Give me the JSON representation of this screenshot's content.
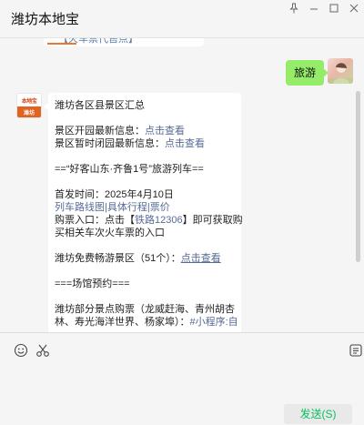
{
  "window": {
    "title": "潍坊本地宝"
  },
  "chat": {
    "previous_card_text": "【火车票代售点】",
    "my_message": "旅游",
    "bot_avatar": {
      "top_text": "本地宝",
      "bottom_text": "潍坊"
    },
    "bot_message": {
      "title": "潍坊各区县景区汇总",
      "open_prefix": "景区开园最新信息：",
      "open_link": "点击查看",
      "closed_prefix": "景区暂时闭园最新信息：",
      "closed_link": "点击查看",
      "train_heading": "==“好客山东·齐鲁1号”旅游列车==",
      "first_departure": "首发时间：2025年4月10日",
      "train_links": [
        "列车路线图",
        "具体行程",
        "票价"
      ],
      "link_sep": "|",
      "ticket_prefix": "购票入口：点击【",
      "ticket_link": "铁路12306",
      "ticket_suffix": "】即可获取购",
      "ticket_line2": "买相关车次火车票的入口",
      "free_prefix": "潍坊免费畅游景区（51个）：",
      "free_link": "点击查看",
      "venue_heading": "===场馆预约===",
      "partial_line1": "潍坊部分景点购票（龙威赶海、青州胡杏",
      "partial_line2_prefix": "林、寿光海洋世界、杨家埠）：",
      "partial_line2_link": "#小程序:自"
    }
  },
  "input": {
    "send_label": "发送(S)"
  },
  "icons": {
    "pin": "pin-icon",
    "minimize": "minimize-icon",
    "maximize": "maximize-icon",
    "close": "close-icon",
    "emoji": "emoji-icon",
    "scissors": "scissors-icon",
    "chat_history": "chat-history-icon"
  },
  "colors": {
    "send_text": "#07c160",
    "my_bubble": "#95ec69",
    "link": "#576b95"
  }
}
